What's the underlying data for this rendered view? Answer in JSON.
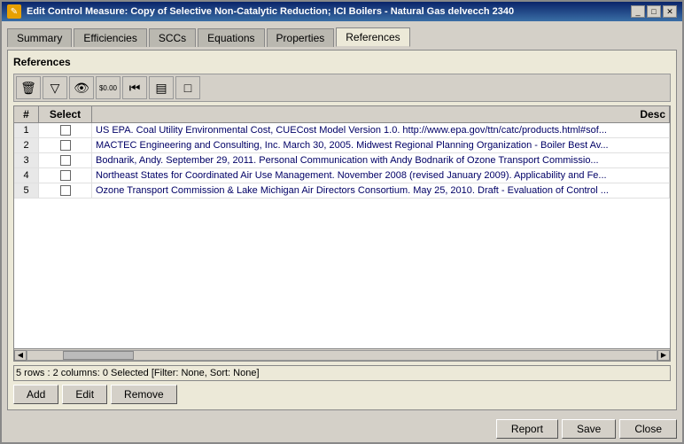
{
  "window": {
    "title": "Edit Control Measure: Copy of Selective Non-Catalytic Reduction; ICI Boilers - Natural Gas delvecch 2340",
    "icon": "✎"
  },
  "tabs": [
    {
      "label": "Summary",
      "active": false
    },
    {
      "label": "Efficiencies",
      "active": false
    },
    {
      "label": "SCCs",
      "active": false
    },
    {
      "label": "Equations",
      "active": false
    },
    {
      "label": "Properties",
      "active": false
    },
    {
      "label": "References",
      "active": true
    }
  ],
  "panel": {
    "title": "References",
    "toolbar": {
      "buttons": [
        {
          "name": "delete-btn",
          "icon": "trash",
          "label": "🗑"
        },
        {
          "name": "filter-btn",
          "icon": "filter",
          "label": "▽"
        },
        {
          "name": "view-btn",
          "icon": "eye",
          "label": "👁"
        },
        {
          "name": "dollar-btn",
          "icon": "dollar",
          "label": "$0.00"
        },
        {
          "name": "rewind-btn",
          "icon": "rewind",
          "label": "⏮"
        },
        {
          "name": "grid-btn",
          "icon": "grid",
          "label": "▤"
        },
        {
          "name": "square-btn",
          "icon": "square",
          "label": "□"
        }
      ]
    },
    "table": {
      "columns": [
        "#",
        "Select",
        "Description"
      ],
      "rows": [
        {
          "num": "1",
          "selected": false,
          "desc": "US EPA. Coal Utility Environmental Cost,  CUECost Model Version 1.0. http://www.epa.gov/ttn/catc/products.html#sof..."
        },
        {
          "num": "2",
          "selected": false,
          "desc": "MACTEC Engineering and Consulting, Inc. March 30, 2005. Midwest Regional Planning Organization - Boiler Best Av..."
        },
        {
          "num": "3",
          "selected": false,
          "desc": "Bodnarik, Andy. September 29, 2011.  Personal Communication with Andy Bodnarik of Ozone Transport Commissio..."
        },
        {
          "num": "4",
          "selected": false,
          "desc": "Northeast States for Coordinated Air Use Management. November 2008 (revised January 2009). Applicability and Fe..."
        },
        {
          "num": "5",
          "selected": false,
          "desc": "Ozone Transport Commission & Lake Michigan Air Directors Consortium. May 25, 2010. Draft - Evaluation of Control ..."
        }
      ]
    },
    "status": "5 rows : 2 columns: 0 Selected [Filter: None, Sort: None]",
    "buttons": {
      "add": "Add",
      "edit": "Edit",
      "remove": "Remove"
    }
  },
  "footer": {
    "report": "Report",
    "save": "Save",
    "close": "Close"
  }
}
